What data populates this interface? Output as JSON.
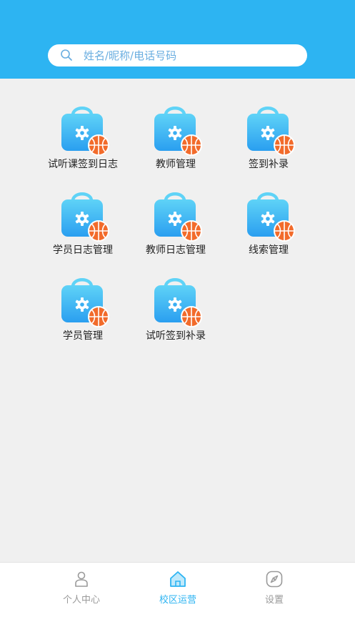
{
  "search": {
    "placeholder": "姓名/昵称/电话号码",
    "value": ""
  },
  "menu": {
    "items": [
      {
        "label": "试听课签到日志"
      },
      {
        "label": "教师管理"
      },
      {
        "label": "签到补录"
      },
      {
        "label": "学员日志管理"
      },
      {
        "label": "教师日志管理"
      },
      {
        "label": "线索管理"
      },
      {
        "label": "学员管理"
      },
      {
        "label": "试听签到补录"
      }
    ]
  },
  "tabbar": {
    "tabs": [
      {
        "label": "个人中心",
        "icon": "person-icon"
      },
      {
        "label": "校区运营",
        "icon": "home-icon",
        "active": true
      },
      {
        "label": "设置",
        "icon": "compass-icon"
      }
    ]
  },
  "colors": {
    "brand": "#2db4f2",
    "background": "#f0f0f0",
    "badge": "#f26b2b",
    "tab_inactive": "#9a9a9a"
  }
}
